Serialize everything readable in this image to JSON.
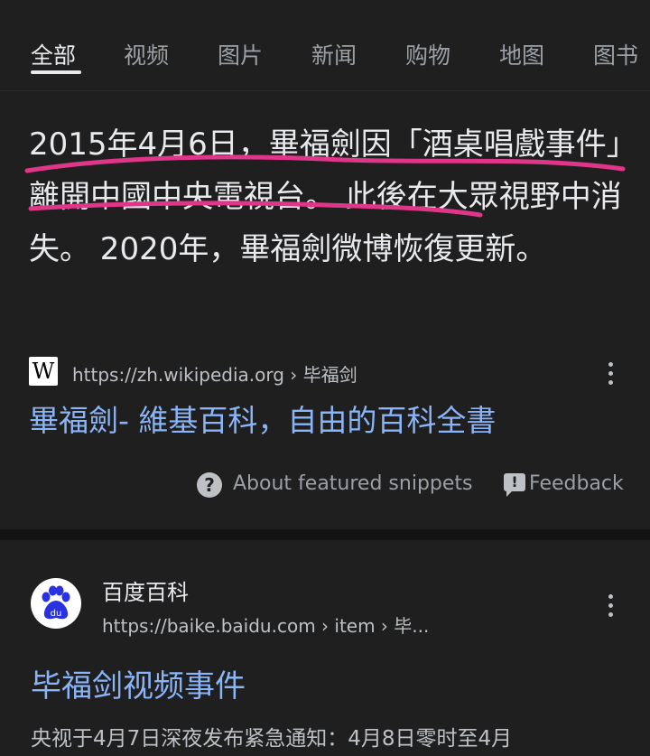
{
  "tabs": [
    {
      "label": "全部",
      "active": true
    },
    {
      "label": "视频"
    },
    {
      "label": "图片"
    },
    {
      "label": "新闻"
    },
    {
      "label": "购物"
    },
    {
      "label": "地图"
    },
    {
      "label": "图书"
    }
  ],
  "featured_snippet": {
    "text": "2015年4月6日，畢福劍因「酒桌唱戲事件」離開中國中央電視台。 此後在大眾視野中消失。 2020年，畢福劍微博恢復更新。",
    "source_icon": "W",
    "source_url": "https://zh.wikipedia.org › 毕福剑",
    "link_title": "畢福劍- 維基百科，自由的百科全書",
    "about_label": "About featured snippets",
    "feedback_label": "Feedback"
  },
  "result2": {
    "site_name": "百度百科",
    "url": "https://baike.baidu.com › item › 毕...",
    "title": "毕福剑视频事件",
    "description": "央视于4月7日深夜发布紧急通知：4月8日零时至4月"
  },
  "colors": {
    "link": "#8ab4f8",
    "annotation": "#e0368a",
    "background": "#1f1f1f"
  },
  "icons": [
    "wikipedia-icon",
    "more-vert-icon",
    "help-icon",
    "feedback-icon",
    "baidu-icon"
  ]
}
